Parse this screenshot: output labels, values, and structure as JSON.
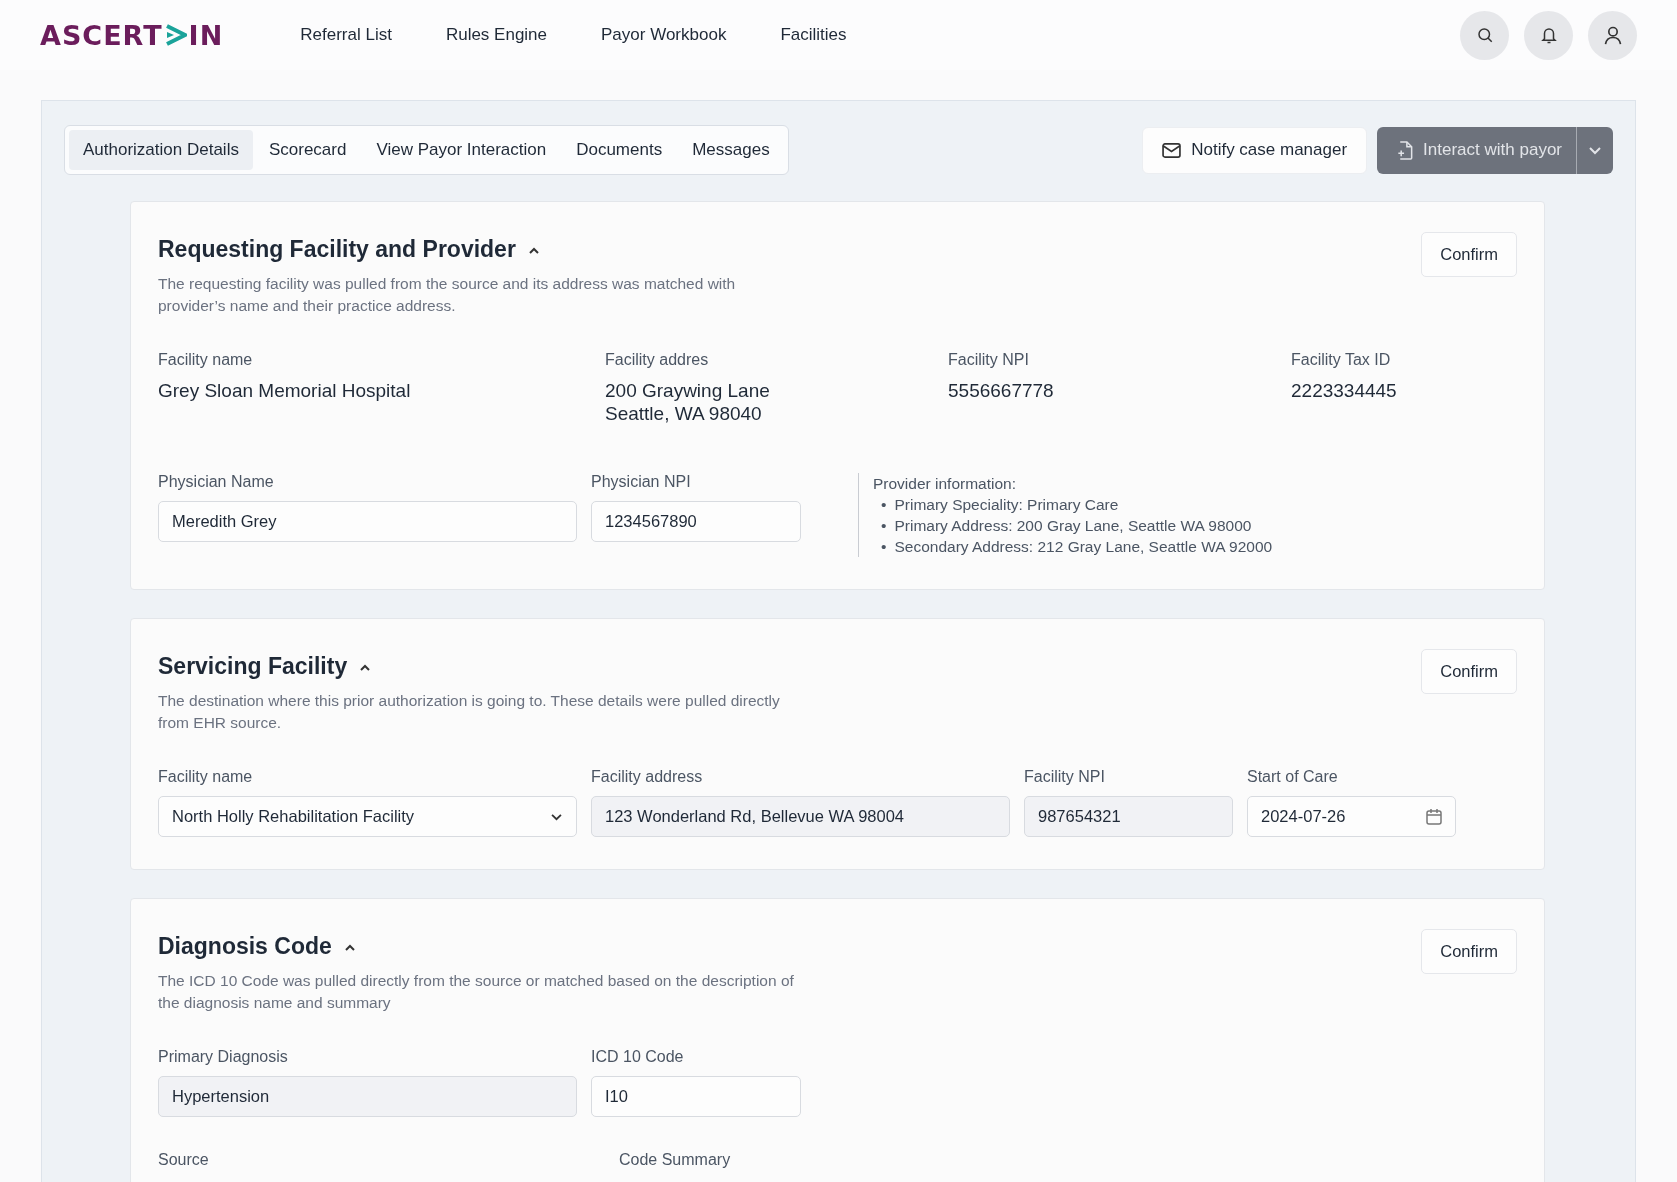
{
  "header": {
    "logo": {
      "before": "ASCERT",
      "after": "IN"
    },
    "nav": [
      {
        "label": "Referral List"
      },
      {
        "label": "Rules Engine"
      },
      {
        "label": "Payor Workbook"
      },
      {
        "label": "Facilities"
      }
    ]
  },
  "tabs": [
    {
      "label": "Authorization Details",
      "selected": true
    },
    {
      "label": "Scorecard",
      "selected": false
    },
    {
      "label": "View Payor Interaction",
      "selected": false
    },
    {
      "label": "Documents",
      "selected": false
    },
    {
      "label": "Messages",
      "selected": false
    }
  ],
  "actions": {
    "notify": "Notify case manager",
    "interact": "Interact with payor"
  },
  "sections": [
    {
      "title": "Requesting Facility and Provider",
      "expanded": true,
      "description": "The requesting facility was pulled from the source and its address was matched with provider’s name and their practice address.",
      "confirm": "Confirm",
      "rows": [
        {
          "fields": [
            {
              "label": "Facility name",
              "value": "Grey Sloan Memorial Hospital",
              "kind": "static"
            },
            {
              "label": "Facility addres",
              "value": "200 Graywing Lane\nSeattle, WA 98040",
              "kind": "static"
            },
            {
              "label": "Facility NPI",
              "value": "5556667778",
              "kind": "static"
            },
            {
              "label": "Facility Tax ID",
              "value": "2223334445",
              "kind": "static"
            }
          ]
        },
        {
          "fields": [
            {
              "label": "Physician Name",
              "value": "Meredith Grey",
              "kind": "input",
              "disabled": false
            },
            {
              "label": "Physician NPI",
              "value": "1234567890",
              "kind": "input",
              "disabled": false
            }
          ],
          "provider_info": {
            "title": "Provider information:",
            "bullet": "•",
            "items": [
              "Primary Speciality: Primary Care",
              "Primary Address: 200 Gray Lane, Seattle WA 98000",
              "Secondary Address: 212 Gray Lane, Seattle WA 92000"
            ]
          }
        }
      ]
    },
    {
      "title": "Servicing Facility",
      "expanded": true,
      "description": "The destination where this prior authorization is going to. These details were pulled directly from EHR source.",
      "confirm": "Confirm",
      "rows": [
        {
          "fields": [
            {
              "label": "Facility name",
              "value": "North Holly Rehabilitation Facility",
              "kind": "select",
              "disabled": false
            },
            {
              "label": "Facility address",
              "value": "123 Wonderland Rd, Bellevue WA 98004",
              "kind": "input",
              "disabled": true
            },
            {
              "label": "Facility NPI",
              "value": "987654321",
              "kind": "input",
              "disabled": true
            },
            {
              "label": "Start of Care",
              "value": "2024-07-26",
              "kind": "date",
              "disabled": false
            }
          ]
        }
      ]
    },
    {
      "title": "Diagnosis Code",
      "expanded": true,
      "description": "The ICD 10 Code was pulled directly from the source or matched based on the description of the diagnosis name and summary",
      "confirm": "Confirm",
      "rows": [
        {
          "fields": [
            {
              "label": "Primary Diagnosis",
              "value": "Hypertension",
              "kind": "input",
              "disabled": true
            },
            {
              "label": "ICD 10 Code",
              "value": "I10",
              "kind": "input",
              "disabled": false
            }
          ]
        },
        {
          "fields": [
            {
              "label": "Source",
              "kind": "label"
            },
            {
              "label": "Code Summary",
              "kind": "label"
            }
          ]
        }
      ]
    }
  ]
}
